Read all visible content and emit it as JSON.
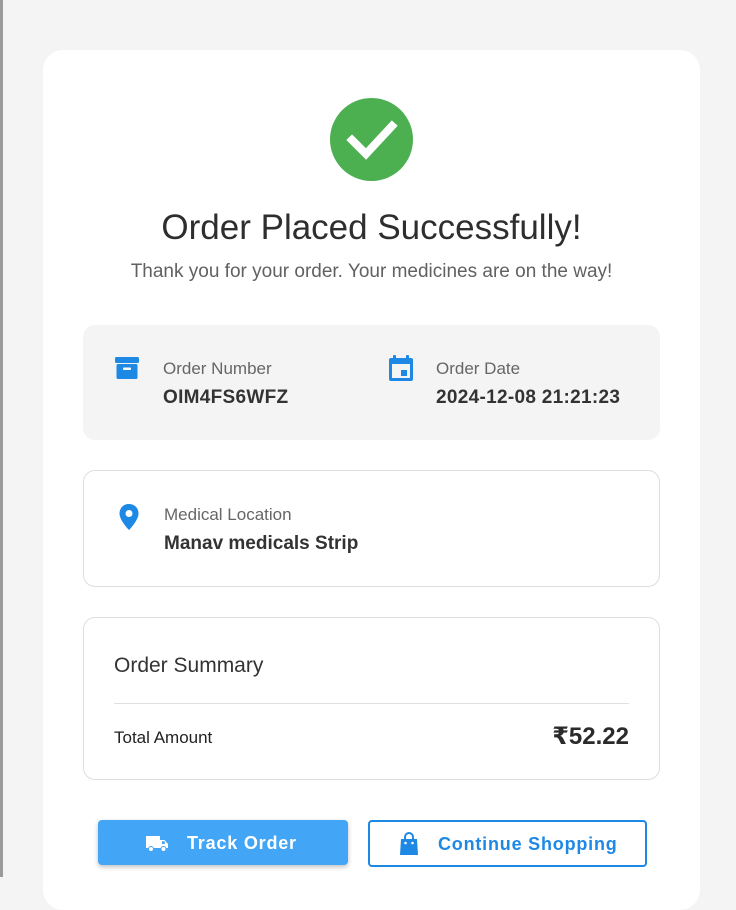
{
  "colors": {
    "success": "#4caf50",
    "primary": "#42a5f5",
    "primary_dark": "#1e88e5",
    "info_background": "#f4f4f4"
  },
  "header": {
    "icon": "check-circle-icon",
    "title": "Order Placed Successfully!",
    "subtitle": "Thank you for your order. Your medicines are on the way!"
  },
  "order_info": {
    "number_icon": "archive-box-icon",
    "number_label": "Order Number",
    "number_value": "OIM4FS6WFZ",
    "date_icon": "calendar-icon",
    "date_label": "Order Date",
    "date_value": "2024-12-08 21:21:23"
  },
  "location": {
    "icon": "location-pin-icon",
    "label": "Medical Location",
    "value": "Manav medicals Strip"
  },
  "summary": {
    "title": "Order Summary",
    "total_label": "Total Amount",
    "total_value": "₹52.22"
  },
  "actions": {
    "track_icon": "truck-icon",
    "track_label": "Track Order",
    "continue_icon": "shopping-bag-icon",
    "continue_label": "Continue Shopping"
  }
}
